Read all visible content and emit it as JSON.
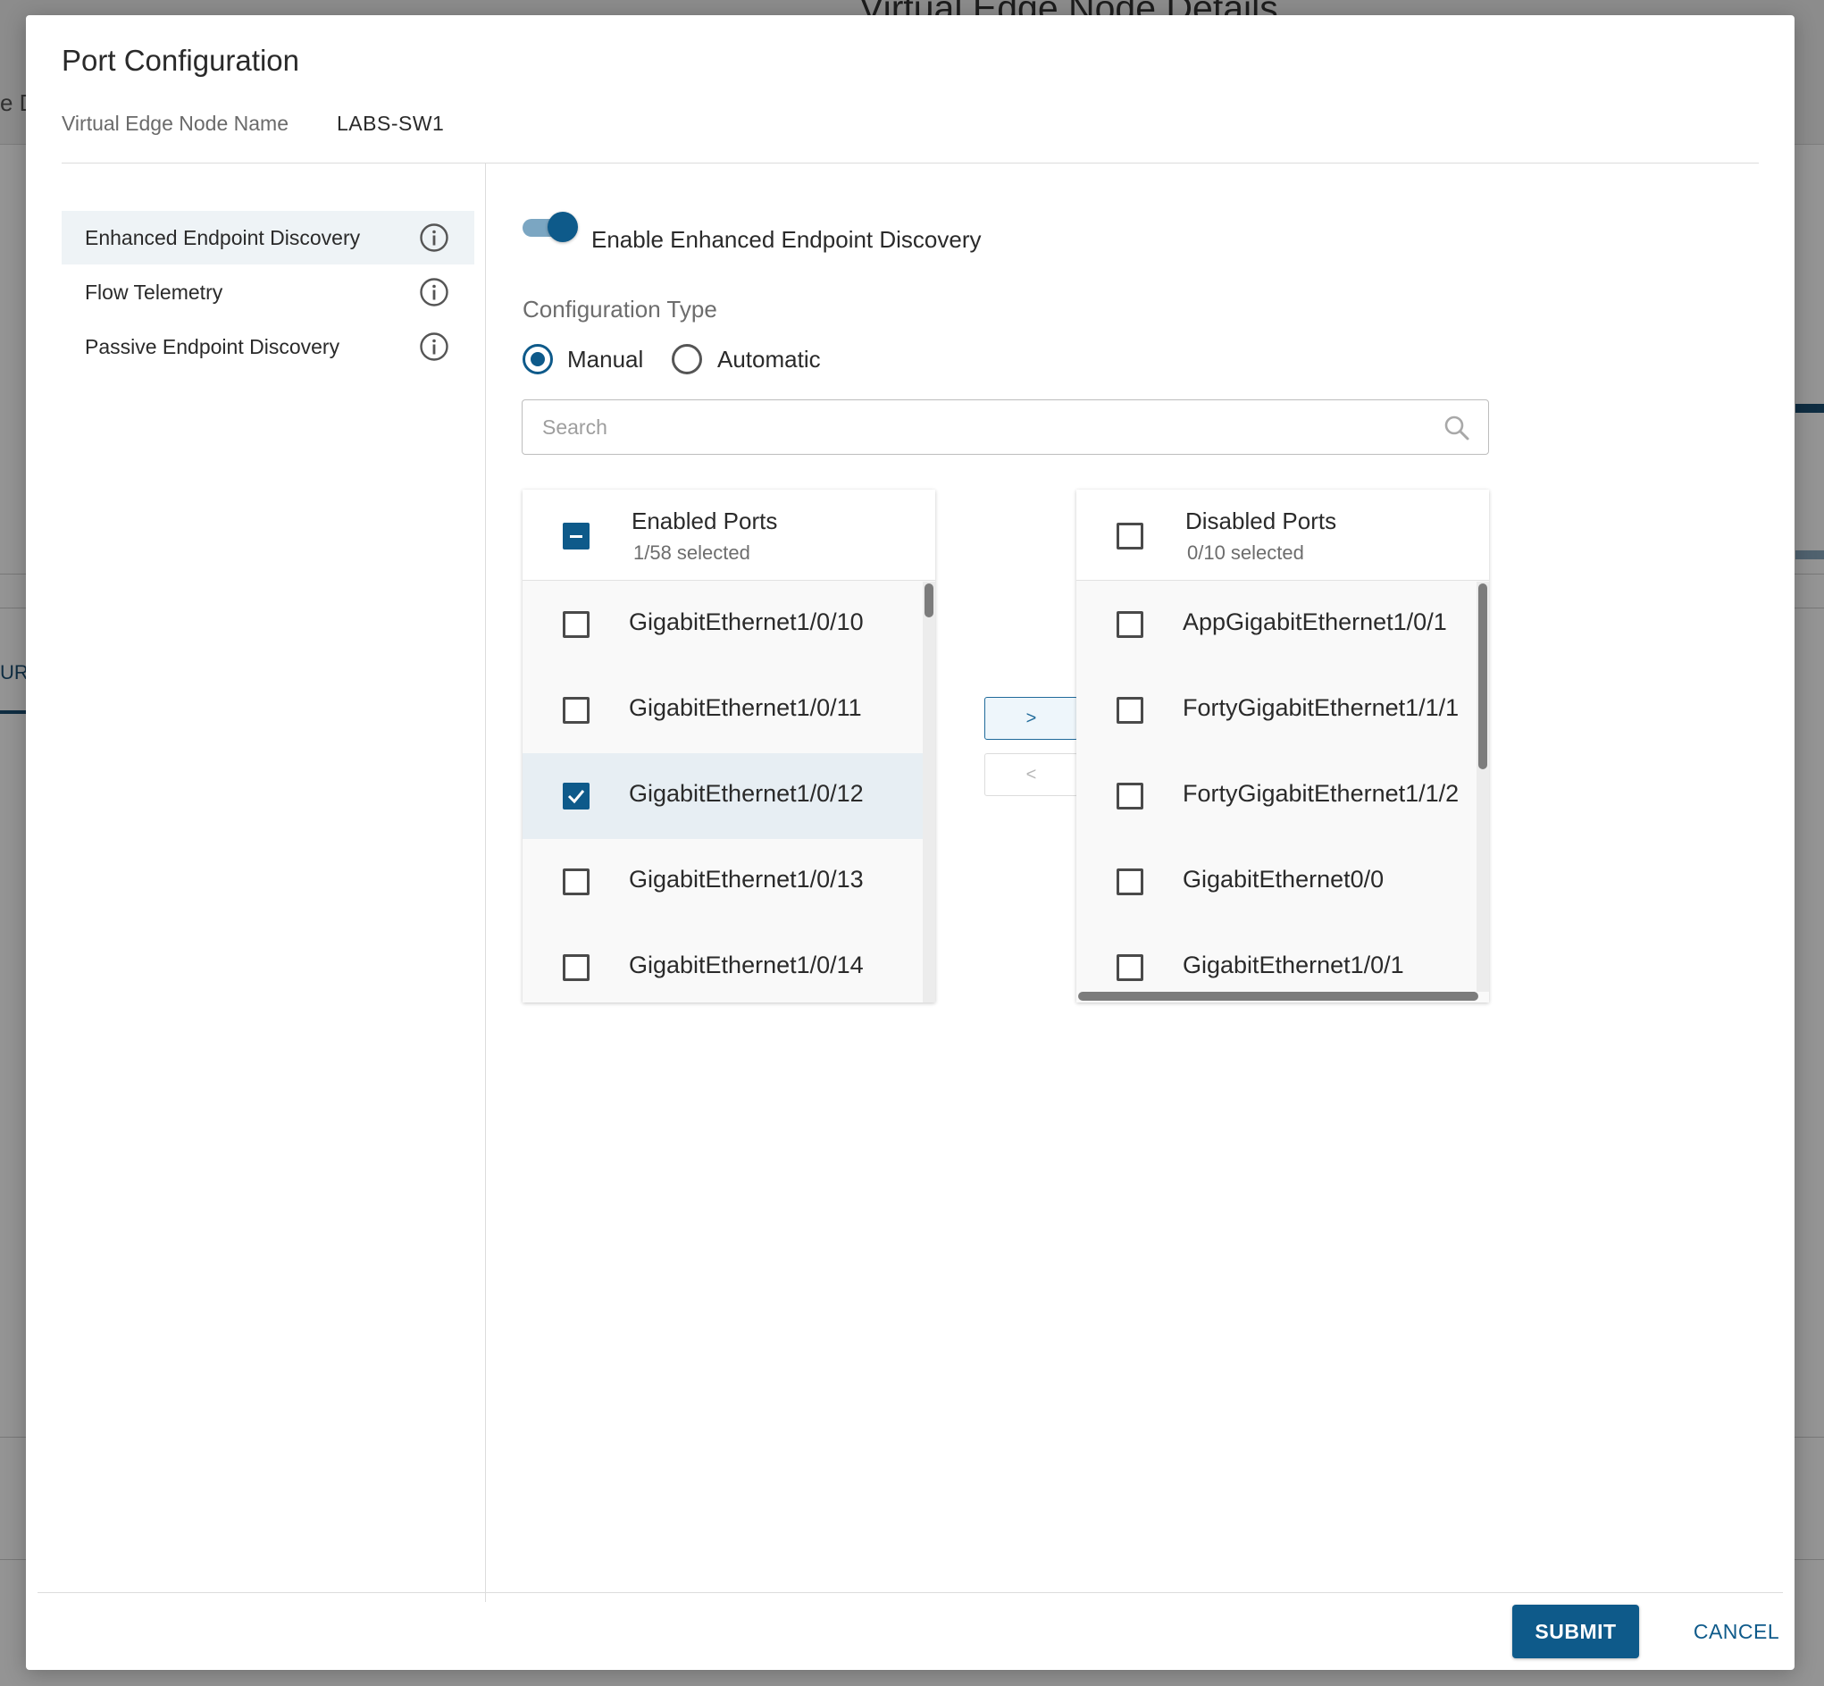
{
  "background": {
    "page_title": "Virtual Edge Node Details",
    "left_fragment": "e D",
    "tab_fragment": "URA"
  },
  "modal": {
    "title": "Port Configuration",
    "node_name_label": "Virtual Edge Node Name",
    "node_name_value": "LABS-SW1"
  },
  "sidebar": {
    "items": [
      {
        "label": "Enhanced Endpoint Discovery",
        "icon": "info-icon",
        "active": true
      },
      {
        "label": "Flow Telemetry",
        "icon": "info-icon",
        "active": false
      },
      {
        "label": "Passive Endpoint Discovery",
        "icon": "info-icon",
        "active": false
      }
    ]
  },
  "main": {
    "toggle_label": "Enable Enhanced Endpoint Discovery",
    "toggle_on": true,
    "config_type_label": "Configuration Type",
    "radios": [
      {
        "label": "Manual",
        "checked": true
      },
      {
        "label": "Automatic",
        "checked": false
      }
    ],
    "search": {
      "placeholder": "Search",
      "value": ""
    }
  },
  "enabled_ports": {
    "title": "Enabled Ports",
    "count": "1/58 selected",
    "rows": [
      {
        "label": "GigabitEthernet1/0/10",
        "checked": false
      },
      {
        "label": "GigabitEthernet1/0/11",
        "checked": false
      },
      {
        "label": "GigabitEthernet1/0/12",
        "checked": true
      },
      {
        "label": "GigabitEthernet1/0/13",
        "checked": false
      },
      {
        "label": "GigabitEthernet1/0/14",
        "checked": false
      }
    ]
  },
  "disabled_ports": {
    "title": "Disabled Ports",
    "count": "0/10 selected",
    "rows": [
      {
        "label": "AppGigabitEthernet1/0/1",
        "checked": false
      },
      {
        "label": "FortyGigabitEthernet1/1/1",
        "checked": false
      },
      {
        "label": "FortyGigabitEthernet1/1/2",
        "checked": false
      },
      {
        "label": "GigabitEthernet0/0",
        "checked": false
      },
      {
        "label": "GigabitEthernet1/0/1",
        "checked": false
      }
    ]
  },
  "transfer": {
    "move_right_label": ">",
    "move_left_label": "<"
  },
  "footer": {
    "submit_label": "SUBMIT",
    "cancel_label": "CANCEL"
  },
  "colors": {
    "accent": "#0e5a8a",
    "selected_row": "#e7eef3",
    "active_nav": "#eef3f6"
  }
}
